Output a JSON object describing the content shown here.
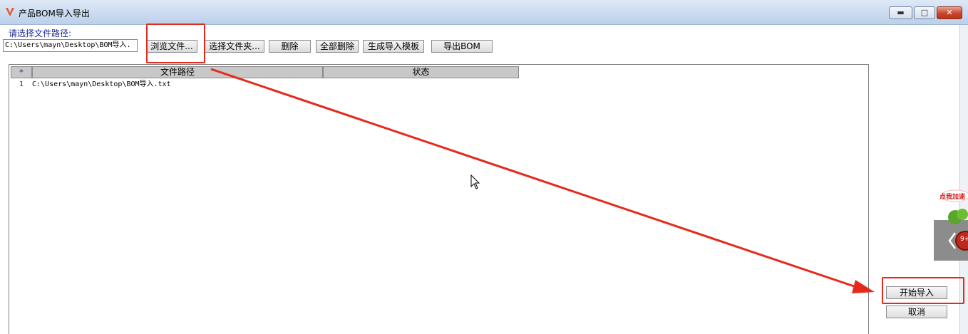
{
  "window": {
    "title": "产品BOM导入导出",
    "minimize_icon": "minimize-icon",
    "maximize_icon": "maximize-icon",
    "close_icon": "close-icon",
    "min_glyph": "▬",
    "max_glyph": "□",
    "close_glyph": "✕"
  },
  "file_panel": {
    "label": "请选择文件路径:",
    "path_value": "C:\\Users\\mayn\\Desktop\\BOM导入."
  },
  "toolbar": {
    "browse_label": "浏览文件...",
    "select_folder_label": "选择文件夹...",
    "delete_label": "删除",
    "delete_all_label": "全部删除",
    "generate_template_label": "生成导入模板",
    "export_label": "导出BOM"
  },
  "grid": {
    "columns": [
      "*",
      "文件路径",
      "状态"
    ],
    "rows": [
      {
        "index": "1",
        "path": "C:\\Users\\mayn\\Desktop\\BOM导入.txt",
        "status": ""
      }
    ]
  },
  "actions": {
    "start_import_label": "开始导入",
    "cancel_label": "取消"
  },
  "widget": {
    "label": "点我加速",
    "badge": "9+",
    "chevron_icon": "chevron-left-icon"
  },
  "colors": {
    "annotation": "#e52a1c",
    "titlebar": "#c9daf0",
    "label_text": "#1d2b8f"
  }
}
